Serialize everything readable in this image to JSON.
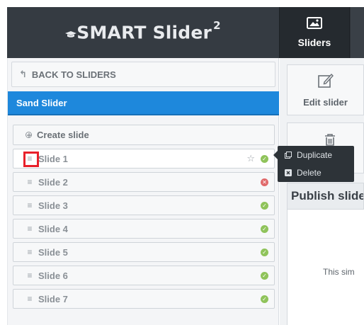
{
  "header": {
    "logo_text": "SMART Slider",
    "logo_sup": "2",
    "nav": [
      {
        "label": "Sliders",
        "icon": "image-icon"
      }
    ]
  },
  "sidebar": {
    "back_label": "BACK TO SLIDERS",
    "slider_name": "Sand Slider",
    "create_label": "Create slide",
    "slides": [
      {
        "label": "Slide 1",
        "status": "published",
        "starred": false
      },
      {
        "label": "Slide 2",
        "status": "unpublished"
      },
      {
        "label": "Slide 3",
        "status": "published"
      },
      {
        "label": "Slide 4",
        "status": "published"
      },
      {
        "label": "Slide 5",
        "status": "published"
      },
      {
        "label": "Slide 6",
        "status": "published"
      },
      {
        "label": "Slide 7",
        "status": "published"
      }
    ]
  },
  "context_menu": {
    "duplicate_label": "Duplicate",
    "delete_label": "Delete"
  },
  "main": {
    "edit_label": "Edit slider",
    "publish_title": "Publish slide",
    "publish_text": "This sim"
  },
  "colors": {
    "accent": "#1e88dc",
    "header_bg": "#353b42",
    "status_ok": "#8fc35a",
    "status_error": "#e0696a",
    "highlight": "#e8202a"
  }
}
